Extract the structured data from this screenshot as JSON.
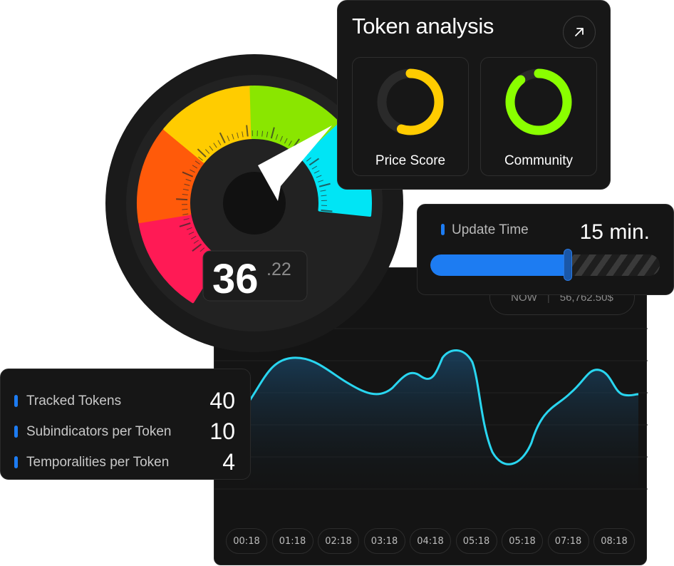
{
  "token_analysis": {
    "title": "Token analysis",
    "open_icon": "arrow-up-right-icon",
    "metrics": [
      {
        "label": "Price Score",
        "percent": 55,
        "color": "#ffcc00"
      },
      {
        "label": "Community",
        "percent": 89,
        "color": "#8aff00"
      }
    ]
  },
  "gauge": {
    "value_int": "36",
    "value_dec": ".22",
    "segment_colors": [
      "#ff1a55",
      "#ff5a0a",
      "#ffcc00",
      "#8ae600",
      "#00e5f5"
    ]
  },
  "update_time": {
    "label": "Update Time",
    "value": "15 min.",
    "progress": 0.6
  },
  "chart": {
    "now_label": "NOW",
    "now_price": "56,762.50$",
    "time_labels": [
      "00:18",
      "01:18",
      "02:18",
      "03:18",
      "04:18",
      "05:18",
      "05:18",
      "07:18",
      "08:18"
    ],
    "line_color": "#29d6f0"
  },
  "stats": [
    {
      "label": "Tracked Tokens",
      "value": "40"
    },
    {
      "label": "Subindicators per Token",
      "value": "10"
    },
    {
      "label": "Temporalities per Token",
      "value": "4"
    }
  ]
}
